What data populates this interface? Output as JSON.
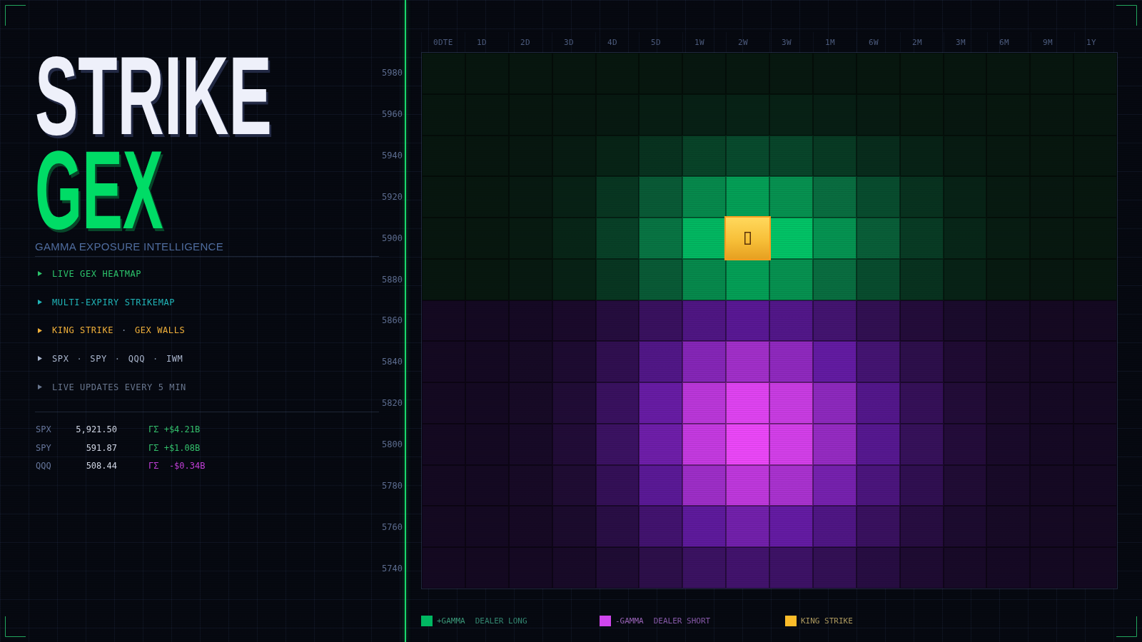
{
  "brand": {
    "primary": "STRIKE",
    "accent": "GEX"
  },
  "tagline": "GAMMA EXPOSURE INTELLIGENCE",
  "features": [
    {
      "parts": [
        "LIVE GEX HEATMAP"
      ],
      "color": "#2cc36b"
    },
    {
      "parts": [
        "MULTI-EXPIRY STRIKEMAP"
      ],
      "color": "#20b5b8"
    },
    {
      "parts": [
        "KING STRIKE",
        "GEX WALLS"
      ],
      "separator": "·",
      "color": "#f0b03a"
    },
    {
      "parts": [
        "SPX",
        "SPY",
        "QQQ",
        "IWM"
      ],
      "separator": "·",
      "color": "#a9b5cc"
    },
    {
      "parts": [
        "LIVE UPDATES EVERY 5 MIN"
      ],
      "color": "#68768e"
    }
  ],
  "tickers": [
    {
      "symbol": "SPX",
      "price": "5,921.50",
      "gex": "ΓΣ +$4.21B",
      "color": "#34c06c"
    },
    {
      "symbol": "SPY",
      "price": "591.87",
      "gex": "ΓΣ +$1.08B",
      "color": "#34c06c"
    },
    {
      "symbol": "QQQ",
      "price": "508.44",
      "gex": "ΓΣ  -$0.34B",
      "color": "#c23fd8"
    }
  ],
  "heatmap": {
    "expiries": [
      {
        "label": "0DTE",
        "king": false
      },
      {
        "label": "1D",
        "king": false
      },
      {
        "label": "2D",
        "king": false
      },
      {
        "label": "3D",
        "king": false
      },
      {
        "label": "4D",
        "king": false
      },
      {
        "label": "5D",
        "king": false
      },
      {
        "label": "1W",
        "king": false
      },
      {
        "label": "2W",
        "king": true
      },
      {
        "label": "3W",
        "king": false
      },
      {
        "label": "1M",
        "king": false
      },
      {
        "label": "6W",
        "king": false
      },
      {
        "label": "2M",
        "king": false
      },
      {
        "label": "3M",
        "king": false
      },
      {
        "label": "6M",
        "king": false
      },
      {
        "label": "9M",
        "king": false
      },
      {
        "label": "1Y",
        "king": false
      }
    ],
    "strikes": [
      {
        "label": "5980",
        "kind": "long",
        "king": false
      },
      {
        "label": "5960",
        "kind": "long",
        "king": false
      },
      {
        "label": "5940",
        "kind": "long",
        "king": false
      },
      {
        "label": "5920",
        "kind": "long",
        "king": false
      },
      {
        "label": "5900",
        "kind": "long",
        "king": true
      },
      {
        "label": "5880",
        "kind": "long",
        "king": false
      },
      {
        "label": "5860",
        "kind": "short",
        "king": false
      },
      {
        "label": "5840",
        "kind": "short",
        "king": false
      },
      {
        "label": "5820",
        "kind": "short",
        "king": false
      },
      {
        "label": "5800",
        "kind": "short",
        "king": false
      },
      {
        "label": "5780",
        "kind": "short",
        "king": false
      },
      {
        "label": "5760",
        "kind": "short",
        "king": false
      },
      {
        "label": "5740",
        "kind": "short",
        "king": false
      }
    ]
  },
  "legend": [
    {
      "color": "#00b862",
      "label": "+GAMMA",
      "note": "DEALER LONG"
    },
    {
      "color": "#d046ee",
      "label": "-GAMMA",
      "note": "DEALER SHORT"
    },
    {
      "color": "#fbbc2a",
      "label": "KING STRIKE"
    }
  ]
}
